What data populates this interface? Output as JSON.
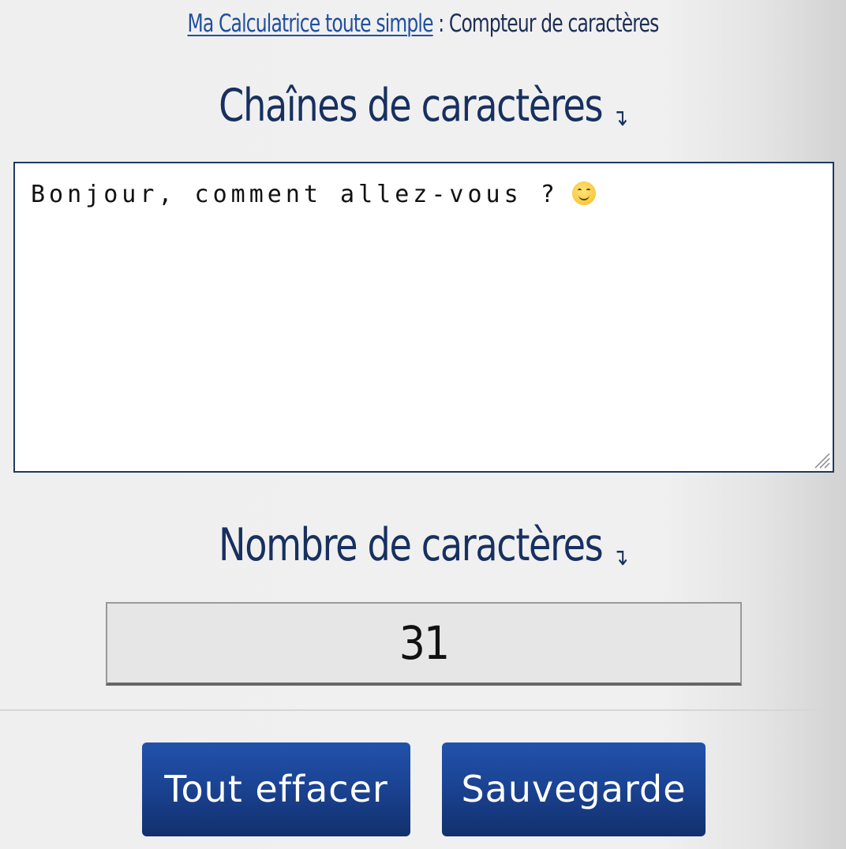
{
  "breadcrumb": {
    "home_link": "Ma Calculatrice toute simple",
    "separator": " : ",
    "current": "Compteur de caractères"
  },
  "sections": {
    "strings_title": "Chaînes de caractères",
    "strings_arrow": "↴",
    "count_title": "Nombre de caractères",
    "count_arrow": "↴"
  },
  "input": {
    "text": "Bonjour, comment allez-vous ? ",
    "emoji": "smiling-face-emoji"
  },
  "result": {
    "count": "31"
  },
  "buttons": {
    "clear_label": "Tout effacer",
    "save_label": "Sauvegarde"
  },
  "colors": {
    "heading": "#17305f",
    "link": "#1f4fa0",
    "button_top": "#2152ab",
    "button_bottom": "#12306c",
    "textarea_border": "#1e3a5f"
  }
}
